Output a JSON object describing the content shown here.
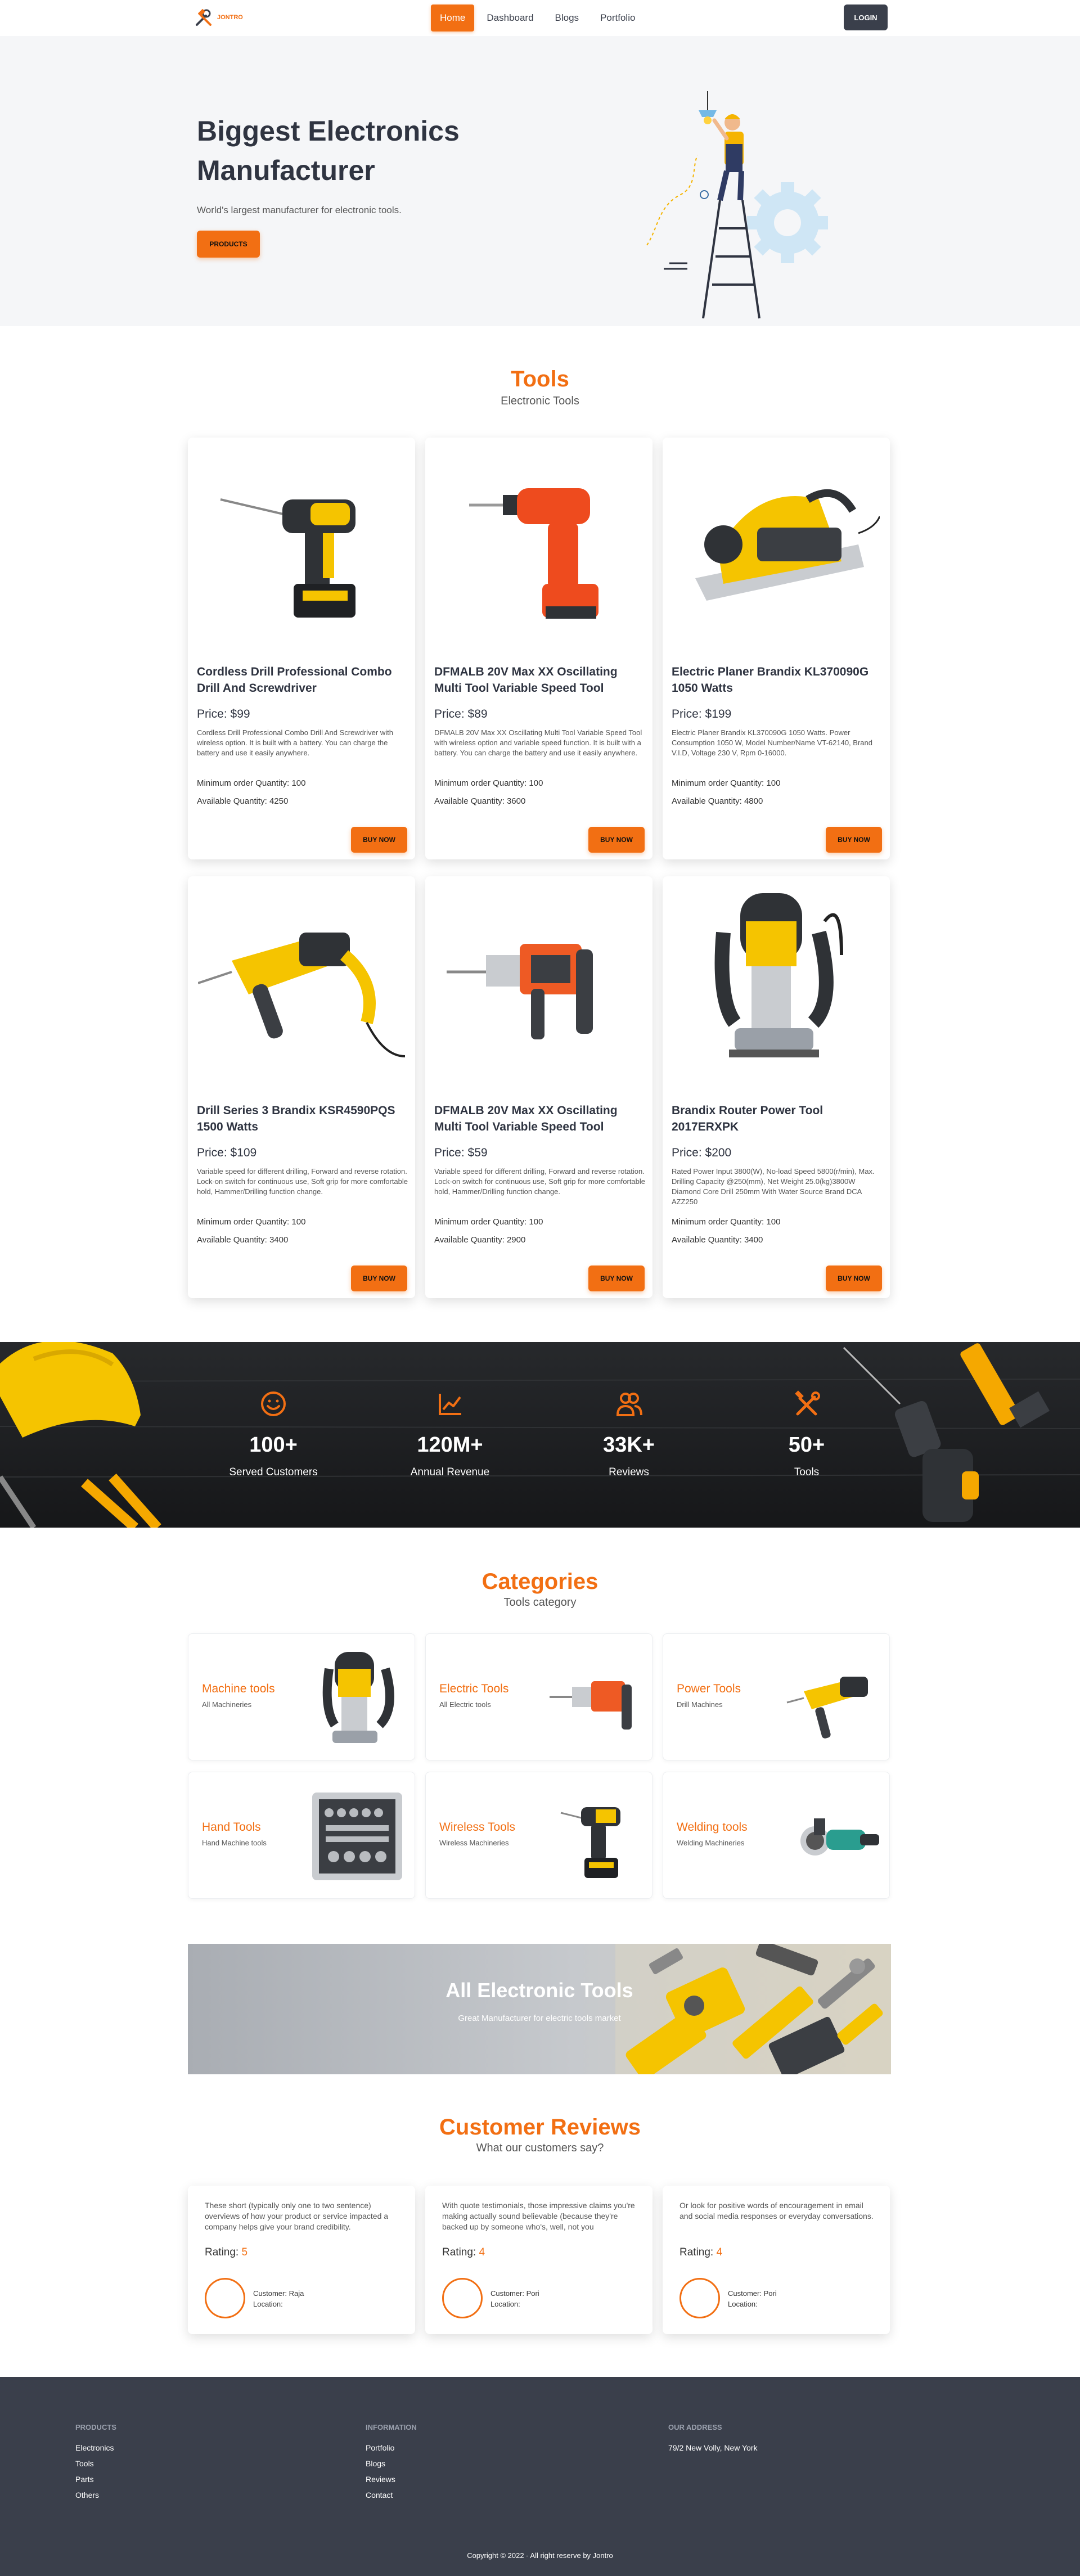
{
  "nav": {
    "logo_text": "JONTRO",
    "links": [
      {
        "label": "Home",
        "active": true
      },
      {
        "label": "Dashboard",
        "active": false
      },
      {
        "label": "Blogs",
        "active": false
      },
      {
        "label": "Portfolio",
        "active": false
      }
    ],
    "login_label": "LOGIN"
  },
  "hero": {
    "title": "Biggest Electronics Manufacturer",
    "subtitle": "World's largest manufacturer for electronic tools.",
    "button_label": "PRODUCTS"
  },
  "tools": {
    "title": "Tools",
    "subtitle": "Electronic Tools",
    "price_prefix": "Price: ",
    "min_prefix": "Minimum order Quantity: ",
    "avail_prefix": "Available Quantity: ",
    "buy_label": "BUY NOW",
    "items": [
      {
        "name": "Cordless Drill Professional Combo Drill And Screwdriver",
        "price": "$99",
        "description": "Cordless Drill Professional Combo Drill And Screwdriver with wireless option. It is built with a battery. You can charge the battery and use it easily anywhere.",
        "min_qty": "100",
        "available": "4250"
      },
      {
        "name": "DFMALB 20V Max XX Oscillating Multi Tool Variable Speed Tool",
        "price": "$89",
        "description": "DFMALB 20V Max XX Oscillating Multi Tool Variable Speed Tool with wireless option and variable speed function. It is built with a battery. You can charge the battery and use it easily anywhere.",
        "min_qty": "100",
        "available": "3600"
      },
      {
        "name": "Electric Planer Brandix KL370090G 1050 Watts",
        "price": "$199",
        "description": "Electric Planer Brandix KL370090G 1050 Watts. Power Consumption 1050 W, Model Number/Name VT-62140, Brand V.I.D, Voltage 230 V, Rpm 0-16000.",
        "min_qty": "100",
        "available": "4800"
      },
      {
        "name": "Drill Series 3 Brandix KSR4590PQS 1500 Watts",
        "price": "$109",
        "description": "Variable speed for different drilling, Forward and reverse rotation. Lock-on switch for continuous use, Soft grip for more comfortable hold, Hammer/Drilling function change.",
        "min_qty": "100",
        "available": "3400"
      },
      {
        "name": "DFMALB 20V Max XX Oscillating Multi Tool Variable Speed Tool",
        "price": "$59",
        "description": "Variable speed for different drilling, Forward and reverse rotation. Lock-on switch for continuous use, Soft grip for more comfortable hold, Hammer/Drilling function change.",
        "min_qty": "100",
        "available": "2900"
      },
      {
        "name": "Brandix Router Power Tool 2017ERXPK",
        "price": "$200",
        "description": "Rated Power Input 3800(W), No-load Speed 5800(r/min), Max. Drilling Capacity @250(mm), Net Weight 25.0(kg)3800W Diamond Core Drill 250mm With Water Source Brand DCA AZZ250",
        "min_qty": "100",
        "available": "3400"
      }
    ]
  },
  "stats": [
    {
      "icon": "smile-icon",
      "value": "100+",
      "label": "Served Customers"
    },
    {
      "icon": "chart-line-icon",
      "value": "120M+",
      "label": "Annual Revenue"
    },
    {
      "icon": "users-icon",
      "value": "33K+",
      "label": "Reviews"
    },
    {
      "icon": "tools-icon",
      "value": "50+",
      "label": "Tools"
    }
  ],
  "categories": {
    "title": "Categories",
    "subtitle": "Tools category",
    "items": [
      {
        "name": "Machine tools",
        "sub": "All Machineries"
      },
      {
        "name": "Electric Tools",
        "sub": "All Electric tools"
      },
      {
        "name": "Power Tools",
        "sub": "Drill Machines"
      },
      {
        "name": "Hand Tools",
        "sub": "Hand Machine tools"
      },
      {
        "name": "Wireless Tools",
        "sub": "Wireless Machineries"
      },
      {
        "name": "Welding tools",
        "sub": "Welding Machineries"
      }
    ]
  },
  "banner": {
    "title": "All Electronic Tools",
    "subtitle": "Great Manufacturer for electric tools market"
  },
  "reviews": {
    "title": "Customer Reviews",
    "subtitle": "What our customers say?",
    "rating_prefix": "Rating: ",
    "customer_prefix": "Customer: ",
    "location_prefix": "Location:",
    "items": [
      {
        "text": "These short (typically only one to two sentence) overviews of how your product or service impacted a company helps give your brand credibility.",
        "rating": "5",
        "customer": "Raja"
      },
      {
        "text": "With quote testimonials, those impressive claims you're making actually sound believable (because they're backed up by someone who's, well, not you",
        "rating": "4",
        "customer": "Pori"
      },
      {
        "text": "Or look for positive words of encouragement in email and social media responses or everyday conversations.",
        "rating": "4",
        "customer": "Pori"
      }
    ]
  },
  "footer": {
    "products_head": "PRODUCTS",
    "products": [
      "Electronics",
      "Tools",
      "Parts",
      "Others"
    ],
    "info_head": "INFORMATION",
    "info": [
      "Portfolio",
      "Blogs",
      "Reviews",
      "Contact"
    ],
    "address_head": "OUR ADDRESS",
    "address": "79/2 New Volly, New York",
    "copyright": "Copyright © 2022 - All right reserve by Jontro"
  },
  "colors": {
    "accent": "#f26f13",
    "dark": "#3a3f4b",
    "hero_bg": "#f5f6f8"
  }
}
